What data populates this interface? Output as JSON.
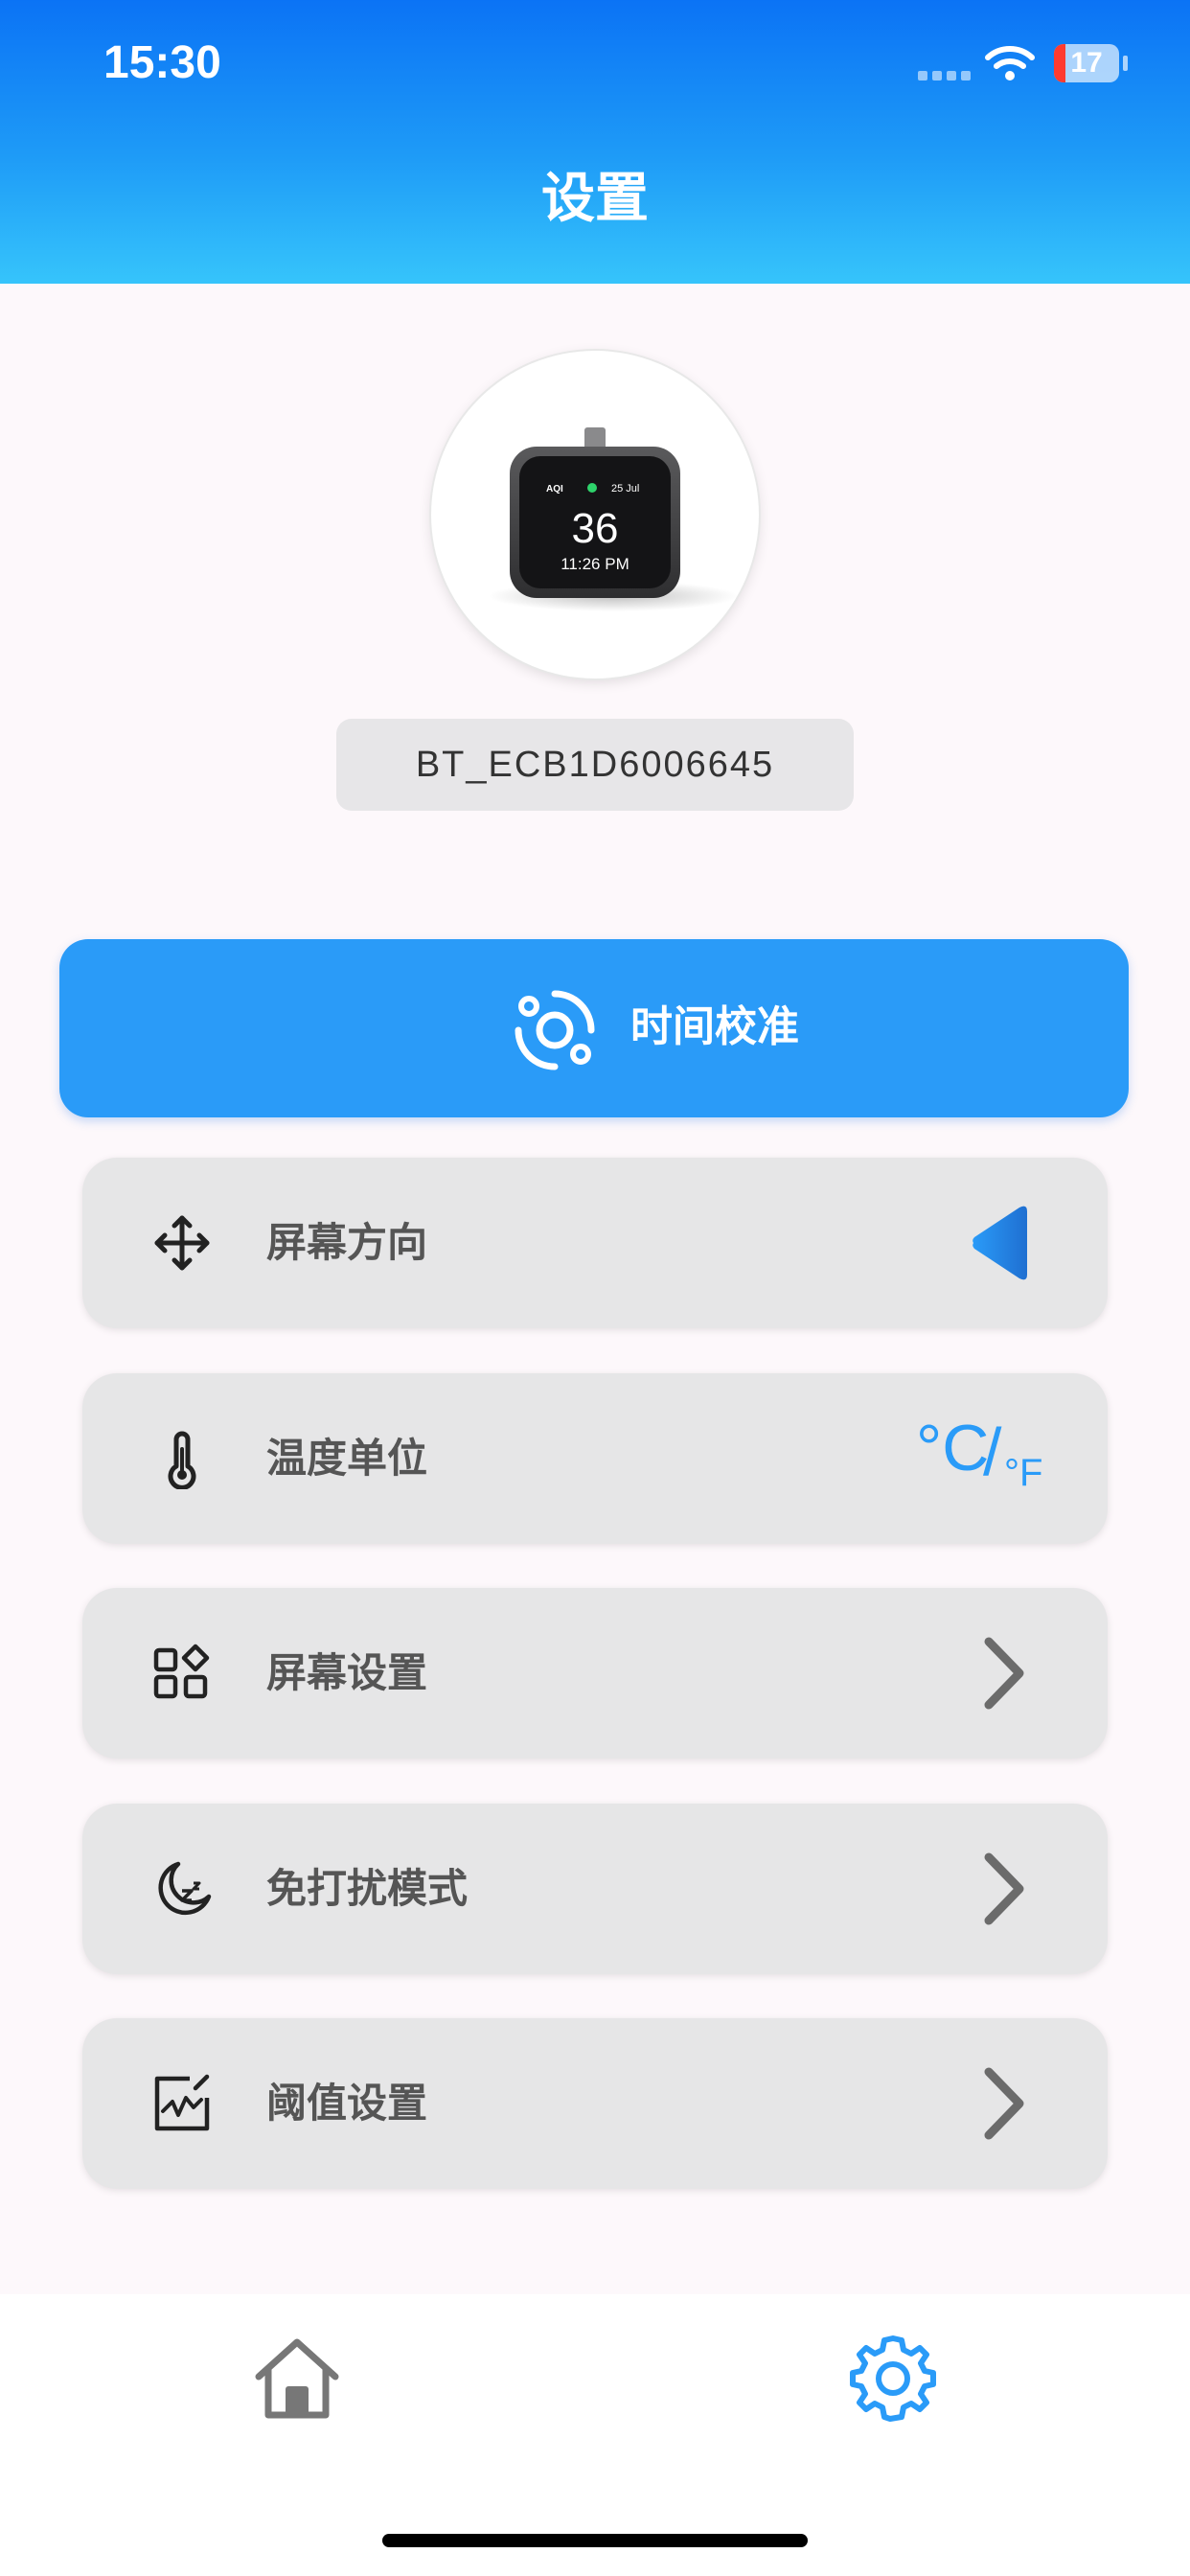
{
  "status_bar": {
    "time": "15:30",
    "battery": "17",
    "battery_level_percent": 17
  },
  "header": {
    "title": "设置"
  },
  "device": {
    "name": "BT_ECB1D6006645",
    "preview": {
      "aqi_label": "AQI",
      "date": "25 Jul",
      "value": "36",
      "time": "11:26 PM"
    }
  },
  "calibration": {
    "label": "时间校准",
    "icon": "time-sync-icon"
  },
  "settings": [
    {
      "label": "屏幕方向",
      "icon": "move-arrows-icon",
      "control": "triangle-left-icon"
    },
    {
      "label": "温度单位",
      "icon": "thermometer-icon",
      "control": "temperature-unit-toggle",
      "unit_primary": "°C",
      "unit_divider": "/",
      "unit_secondary": "°F"
    },
    {
      "label": "屏幕设置",
      "icon": "grid-icon",
      "control": "chevron-right-icon"
    },
    {
      "label": "免打扰模式",
      "icon": "moon-sleep-icon",
      "control": "chevron-right-icon"
    },
    {
      "label": "阈值设置",
      "icon": "chart-edit-icon",
      "control": "chevron-right-icon"
    }
  ],
  "tabbar": {
    "items": [
      {
        "icon": "home-icon",
        "active": false
      },
      {
        "icon": "gear-icon",
        "active": true
      }
    ]
  },
  "colors": {
    "accent": "#2a9bf8",
    "header_top": "#0b73f5",
    "header_bottom": "#36c4fb",
    "inactive_icon": "#777777",
    "chevron": "#6b6b6b"
  }
}
